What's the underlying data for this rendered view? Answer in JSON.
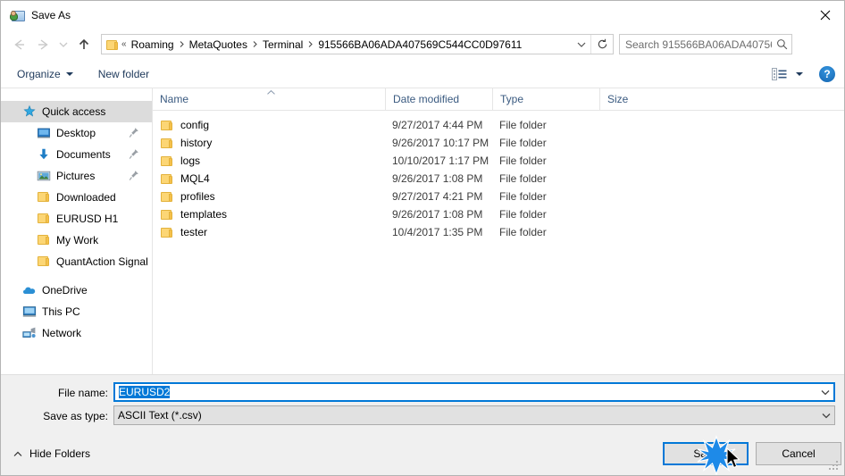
{
  "window": {
    "title": "Save As",
    "icon": "save-as-icon",
    "close_icon": "close-icon"
  },
  "nav": {
    "back_icon": "arrow-left-icon",
    "forward_icon": "arrow-right-icon",
    "recent_icon": "chevron-down-icon",
    "up_icon": "arrow-up-icon",
    "folder_icon": "folder-icon",
    "overflow": "«",
    "breadcrumbs": [
      "Roaming",
      "MetaQuotes",
      "Terminal",
      "915566BA06ADA407569C544CC0D97611"
    ],
    "dropdown_icon": "chevron-down-icon",
    "refresh_icon": "refresh-icon"
  },
  "search": {
    "placeholder": "Search 915566BA06ADA40756...",
    "value": "",
    "icon": "search-icon"
  },
  "toolbar": {
    "organize_label": "Organize",
    "organize_caret": "caret-down-icon",
    "new_folder_label": "New folder",
    "view_icon": "view-options-icon",
    "view_caret": "caret-down-icon",
    "help_label": "?",
    "help_icon": "help-icon"
  },
  "sidebar": {
    "items": [
      {
        "label": "Quick access",
        "icon": "star-icon",
        "level": 0,
        "selected": true,
        "pinned": false
      },
      {
        "label": "Desktop",
        "icon": "desktop-icon",
        "level": 1,
        "selected": false,
        "pinned": true
      },
      {
        "label": "Documents",
        "icon": "documents-icon",
        "level": 1,
        "selected": false,
        "pinned": true
      },
      {
        "label": "Pictures",
        "icon": "pictures-icon",
        "level": 1,
        "selected": false,
        "pinned": true
      },
      {
        "label": "Downloaded",
        "icon": "folder-icon",
        "level": 1,
        "selected": false,
        "pinned": false
      },
      {
        "label": "EURUSD H1",
        "icon": "folder-icon",
        "level": 1,
        "selected": false,
        "pinned": false
      },
      {
        "label": "My Work",
        "icon": "folder-icon",
        "level": 1,
        "selected": false,
        "pinned": false
      },
      {
        "label": "QuantAction Signal",
        "icon": "folder-icon",
        "level": 1,
        "selected": false,
        "pinned": false
      },
      {
        "label": "OneDrive",
        "icon": "onedrive-icon",
        "level": 0,
        "selected": false,
        "pinned": false
      },
      {
        "label": "This PC",
        "icon": "this-pc-icon",
        "level": 0,
        "selected": false,
        "pinned": false
      },
      {
        "label": "Network",
        "icon": "network-icon",
        "level": 0,
        "selected": false,
        "pinned": false
      }
    ]
  },
  "filelist": {
    "columns": [
      {
        "label": "Name",
        "sorted": "ascending"
      },
      {
        "label": "Date modified",
        "sorted": ""
      },
      {
        "label": "Type",
        "sorted": ""
      },
      {
        "label": "Size",
        "sorted": ""
      }
    ],
    "rows": [
      {
        "name": "config",
        "date": "9/27/2017 4:44 PM",
        "type": "File folder",
        "size": "",
        "icon": "folder-icon"
      },
      {
        "name": "history",
        "date": "9/26/2017 10:17 PM",
        "type": "File folder",
        "size": "",
        "icon": "folder-icon"
      },
      {
        "name": "logs",
        "date": "10/10/2017 1:17 PM",
        "type": "File folder",
        "size": "",
        "icon": "folder-icon"
      },
      {
        "name": "MQL4",
        "date": "9/26/2017 1:08 PM",
        "type": "File folder",
        "size": "",
        "icon": "folder-icon"
      },
      {
        "name": "profiles",
        "date": "9/27/2017 4:21 PM",
        "type": "File folder",
        "size": "",
        "icon": "folder-icon"
      },
      {
        "name": "templates",
        "date": "9/26/2017 1:08 PM",
        "type": "File folder",
        "size": "",
        "icon": "folder-icon"
      },
      {
        "name": "tester",
        "date": "10/4/2017 1:35 PM",
        "type": "File folder",
        "size": "",
        "icon": "folder-icon"
      }
    ]
  },
  "form": {
    "filename_label": "File name:",
    "filename_value": "EURUSD2",
    "filename_selected": true,
    "filetype_label": "Save as type:",
    "filetype_value": "ASCII Text (*.csv)",
    "dropdown_icon": "chevron-down-icon"
  },
  "footer": {
    "hide_folders_label": "Hide Folders",
    "hide_folders_icon": "chevron-up-icon",
    "save_label": "Save",
    "cancel_label": "Cancel",
    "resize_grip_icon": "resize-grip-icon",
    "click_indicator_icon": "click-burst-icon",
    "cursor_icon": "mouse-pointer-icon"
  },
  "colors": {
    "accent": "#0078d7",
    "folder_yellow": "#fcd675",
    "header_text": "#3a5a80",
    "panel_bg": "#f0f0f0",
    "selection_bg": "#dcdcdc"
  }
}
